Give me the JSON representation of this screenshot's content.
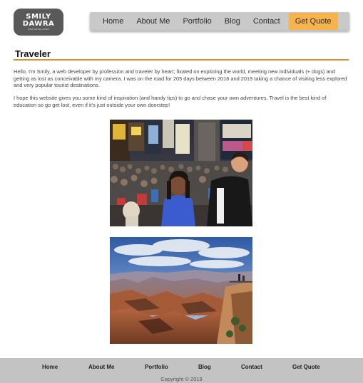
{
  "brand": {
    "logo_line1": "SMILY",
    "logo_line2": "DAWRA",
    "logo_tagline": "WEB DEVELOPER",
    "accent_color": "#f7b34c",
    "rule_color": "#d98f2b"
  },
  "nav": {
    "items": [
      "Home",
      "About Me",
      "Portfolio",
      "Blog",
      "Contact"
    ],
    "cta_label": "Get Quote"
  },
  "page": {
    "title": "Traveler",
    "paragraph1": "Hello, I'm Smily, a web developer by profession and traveler by heart; fixated on exploring the world, meeting new individuals (+ dogs) and getting as lost as conceivable with my camera. I was on the road for 205 days between 2016 and 2019 taking a chance of visiting less explored and very popular tourist destinations.",
    "paragraph2": "I hope this website gives you some kind of inspiration (and handy tips) to go and chase your own adventures. Travel is the best kind of education so go get lost, even if it's just outside your own doorstep!"
  },
  "photos": [
    {
      "subject": "times-square-crowd-photo"
    },
    {
      "subject": "grand-canyon-photo"
    }
  ],
  "footer": {
    "items": [
      "Home",
      "About Me",
      "Portfolio",
      "Blog",
      "Contact",
      "Get Quote"
    ],
    "copyright": "Copyright © 2019"
  }
}
